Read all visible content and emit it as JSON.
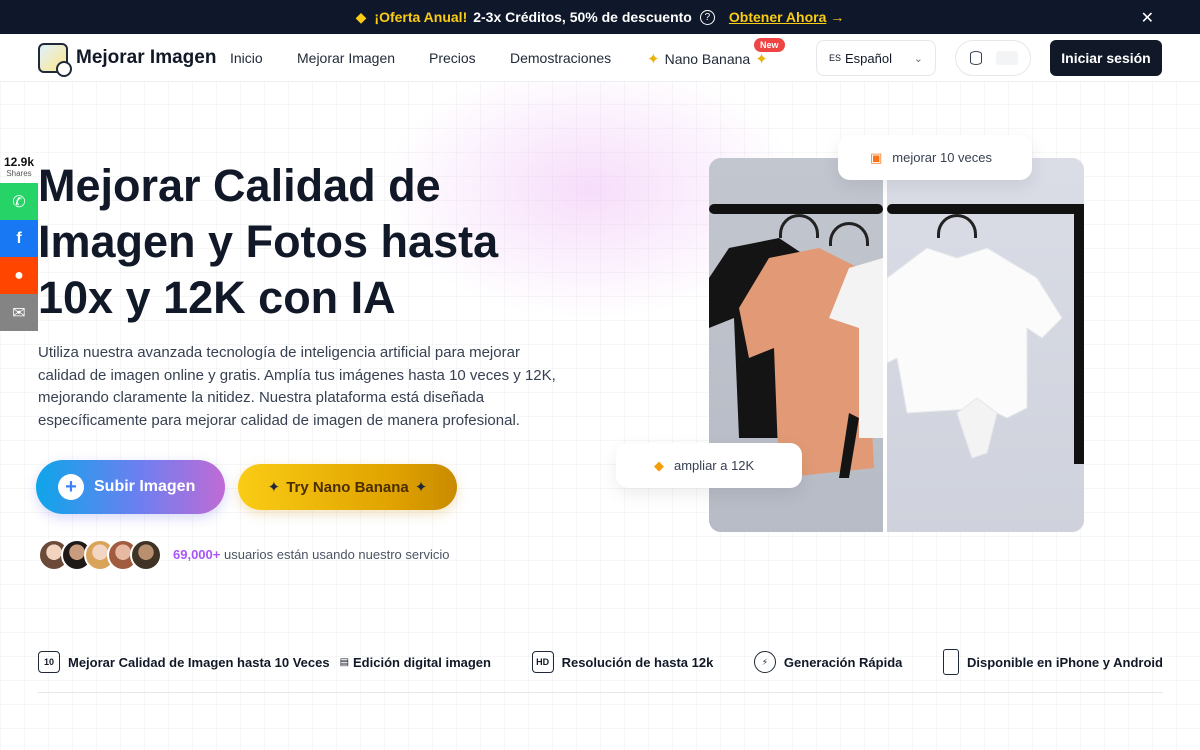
{
  "promo": {
    "highlight": "¡Oferta Anual!",
    "text": "2-3x Créditos, 50% de descuento",
    "cta": "Obtener Ahora",
    "icon": "price-tag-icon"
  },
  "nav": {
    "logo_text": "Mejorar Imagen",
    "links": [
      "Inicio",
      "Mejorar Imagen",
      "Precios",
      "Demostraciones"
    ],
    "nano_label": "Nano Banana",
    "new_badge": "New",
    "language_code": "ES",
    "language": "Español",
    "login": "Iniciar sesión"
  },
  "share": {
    "count": "12.9k",
    "label": "Shares",
    "buttons": [
      {
        "name": "whatsapp",
        "color": "#25d366"
      },
      {
        "name": "facebook",
        "color": "#1877f2"
      },
      {
        "name": "reddit",
        "color": "#ff4500"
      },
      {
        "name": "email",
        "color": "#848484"
      }
    ]
  },
  "hero": {
    "title": "Mejorar Calidad de Imagen y Fotos hasta 10x y 12K con IA",
    "description": "Utiliza nuestra avanzada tecnología de inteligencia artificial para mejorar calidad de imagen online y gratis. Amplía tus imágenes hasta 10 veces y 12K, mejorando claramente la nitidez. Nuestra plataforma está diseñada específicamente para mejorar calidad de imagen de manera profesional.",
    "upload_label": "Subir Imagen",
    "nano_button": "Try Nano Banana",
    "users_count": "69,000+",
    "users_text": "usuarios están usando nuestro servicio"
  },
  "compare": {
    "top_pill": "mejorar 10 veces",
    "bottom_pill": "ampliar a 12K"
  },
  "features": [
    {
      "icon": "10x-icon",
      "label": "Mejorar Calidad de Imagen hasta 10 Veces"
    },
    {
      "icon": "image-edit-icon",
      "label": "Edición digital imagen"
    },
    {
      "icon": "hd-icon",
      "label": "Resolución de hasta 12k"
    },
    {
      "icon": "lightning-icon",
      "label": "Generación Rápida"
    },
    {
      "icon": "phone-icon",
      "label": "Disponible en iPhone y Android"
    }
  ],
  "colors": {
    "promo_bg": "#0f172a",
    "promo_accent": "#facc15",
    "primary_dark": "#111827",
    "users_accent": "#a855f7"
  }
}
